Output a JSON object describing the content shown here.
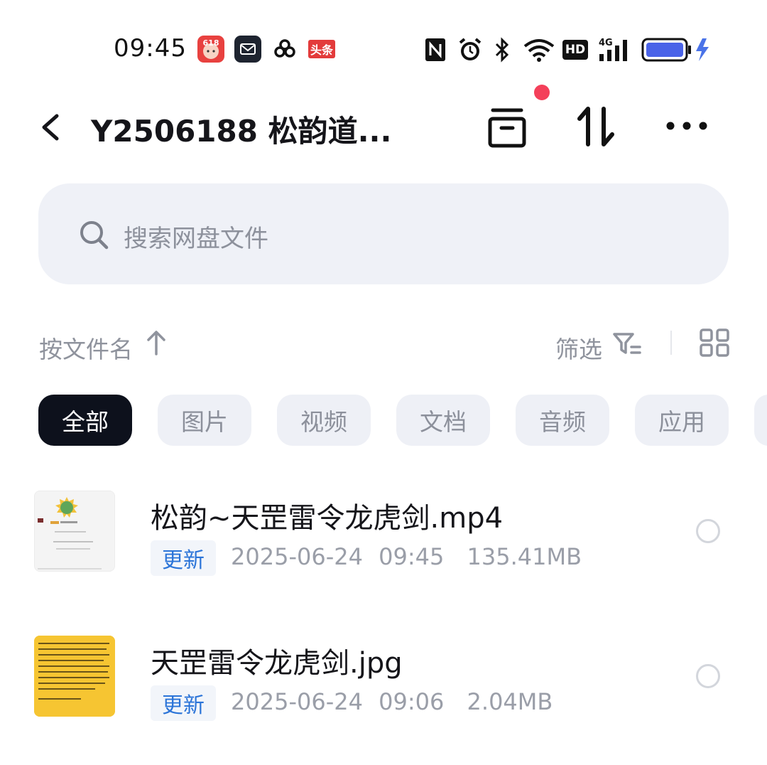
{
  "status_bar": {
    "time": "09:45",
    "apps": [
      "shopping-618-icon",
      "mail-icon",
      "cloud-app-icon",
      "toutiao-icon"
    ],
    "toutiao_label": "头条",
    "badge_618": "618",
    "hd_label": "HD",
    "network_label": "4G"
  },
  "header": {
    "title": "Y2506188 松韵道..."
  },
  "search": {
    "placeholder": "搜索网盘文件"
  },
  "sort": {
    "label": "按文件名",
    "filter_label": "筛选"
  },
  "chips": [
    {
      "label": "全部",
      "active": true
    },
    {
      "label": "图片",
      "active": false
    },
    {
      "label": "视频",
      "active": false
    },
    {
      "label": "文档",
      "active": false
    },
    {
      "label": "音频",
      "active": false
    },
    {
      "label": "应用",
      "active": false
    }
  ],
  "files": [
    {
      "name": "松韵~天罡雷令龙虎剑.mp4",
      "badge": "更新",
      "date": "2025-06-24",
      "time": "09:45",
      "size": "135.41MB"
    },
    {
      "name": "天罡雷令龙虎剑.jpg",
      "badge": "更新",
      "date": "2025-06-24",
      "time": "09:06",
      "size": "2.04MB"
    }
  ],
  "colors": {
    "accent_red": "#f4405a",
    "badge_blue": "#2b74d8",
    "chip_active": "#0d111c",
    "search_bg": "#eff1f7",
    "battery_fill": "#4a63e8"
  }
}
